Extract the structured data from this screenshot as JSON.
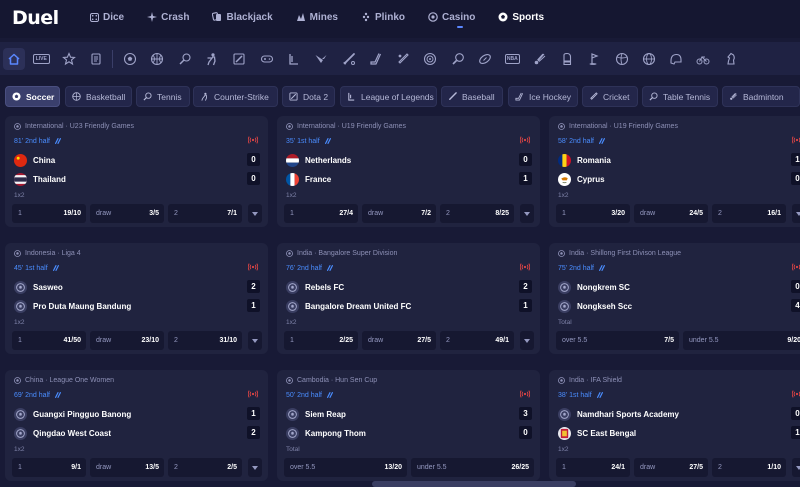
{
  "brand": {
    "logo": "Duel"
  },
  "topnav": [
    {
      "label": "Dice",
      "icon": "dice-icon"
    },
    {
      "label": "Crash",
      "icon": "crash-icon"
    },
    {
      "label": "Blackjack",
      "icon": "cards-icon"
    },
    {
      "label": "Mines",
      "icon": "mines-icon"
    },
    {
      "label": "Plinko",
      "icon": "plinko-icon"
    },
    {
      "label": "Casino",
      "icon": "casino-chip-icon"
    },
    {
      "label": "Sports",
      "icon": "soccer-ball-icon",
      "active": true
    }
  ],
  "iconbar": {
    "live_label": "LIVE",
    "nba_label": "NBA"
  },
  "categories": [
    {
      "label": "Soccer",
      "active": true
    },
    {
      "label": "Basketball"
    },
    {
      "label": "Tennis"
    },
    {
      "label": "Counter-Strike"
    },
    {
      "label": "Dota 2"
    },
    {
      "label": "League of Legends"
    },
    {
      "label": "Baseball"
    },
    {
      "label": "Ice Hockey"
    },
    {
      "label": "Cricket"
    },
    {
      "label": "Table Tennis"
    },
    {
      "label": "Badminton"
    }
  ],
  "matches": [
    {
      "league": "International · U23 Friendly Games",
      "time": "81' 2nd half",
      "teams": [
        {
          "name": "China",
          "score": "0",
          "flag": "china"
        },
        {
          "name": "Thailand",
          "score": "0",
          "flag": "thailand"
        }
      ],
      "market": "1x2",
      "odds": [
        {
          "label": "1",
          "value": "19/10"
        },
        {
          "label": "draw",
          "value": "3/5"
        },
        {
          "label": "2",
          "value": "7/1"
        }
      ]
    },
    {
      "league": "International · U19 Friendly Games",
      "time": "35' 1st half",
      "teams": [
        {
          "name": "Netherlands",
          "score": "0",
          "flag": "netherlands"
        },
        {
          "name": "France",
          "score": "1",
          "flag": "france"
        }
      ],
      "market": "1x2",
      "odds": [
        {
          "label": "1",
          "value": "27/4"
        },
        {
          "label": "draw",
          "value": "7/2"
        },
        {
          "label": "2",
          "value": "8/25"
        }
      ]
    },
    {
      "league": "International · U19 Friendly Games",
      "time": "58' 2nd half",
      "teams": [
        {
          "name": "Romania",
          "score": "1",
          "flag": "romania"
        },
        {
          "name": "Cyprus",
          "score": "0",
          "flag": "cyprus"
        }
      ],
      "market": "1x2",
      "odds": [
        {
          "label": "1",
          "value": "3/20"
        },
        {
          "label": "draw",
          "value": "24/5"
        },
        {
          "label": "2",
          "value": "16/1"
        }
      ]
    },
    {
      "league": "Indonesia · Liga 4",
      "time": "45' 1st half",
      "teams": [
        {
          "name": "Sasweo",
          "score": "2",
          "flag": "generic"
        },
        {
          "name": "Pro Duta Maung Bandung",
          "score": "1",
          "flag": "generic"
        }
      ],
      "market": "1x2",
      "odds": [
        {
          "label": "1",
          "value": "41/50"
        },
        {
          "label": "draw",
          "value": "23/10"
        },
        {
          "label": "2",
          "value": "31/10"
        }
      ]
    },
    {
      "league": "India · Bangalore Super Division",
      "time": "76' 2nd half",
      "teams": [
        {
          "name": "Rebels FC",
          "score": "2",
          "flag": "generic"
        },
        {
          "name": "Bangalore Dream United FC",
          "score": "1",
          "flag": "generic"
        }
      ],
      "market": "1x2",
      "odds": [
        {
          "label": "1",
          "value": "2/25"
        },
        {
          "label": "draw",
          "value": "27/5"
        },
        {
          "label": "2",
          "value": "49/1"
        }
      ]
    },
    {
      "league": "India · Shillong First Divison League",
      "time": "75' 2nd half",
      "teams": [
        {
          "name": "Nongkrem SC",
          "score": "0",
          "flag": "generic"
        },
        {
          "name": "Nongkseh Scc",
          "score": "4",
          "flag": "generic"
        }
      ],
      "market": "Total",
      "odds": [
        {
          "label": "over 5.5",
          "value": "7/5"
        },
        {
          "label": "under 5.5",
          "value": "9/20"
        }
      ]
    },
    {
      "league": "China · League One Women",
      "time": "69' 2nd half",
      "teams": [
        {
          "name": "Guangxi Pingguo Banong",
          "score": "1",
          "flag": "generic"
        },
        {
          "name": "Qingdao West Coast",
          "score": "2",
          "flag": "generic"
        }
      ],
      "market": "1x2",
      "odds": [
        {
          "label": "1",
          "value": "9/1"
        },
        {
          "label": "draw",
          "value": "13/5"
        },
        {
          "label": "2",
          "value": "2/5"
        }
      ]
    },
    {
      "league": "Cambodia · Hun Sen Cup",
      "time": "50' 2nd half",
      "teams": [
        {
          "name": "Siem Reap",
          "score": "3",
          "flag": "generic"
        },
        {
          "name": "Kampong Thom",
          "score": "0",
          "flag": "generic"
        }
      ],
      "market": "Total",
      "odds": [
        {
          "label": "over 5.5",
          "value": "13/20"
        },
        {
          "label": "under 5.5",
          "value": "26/25"
        }
      ]
    },
    {
      "league": "India · IFA Shield",
      "time": "38' 1st half",
      "teams": [
        {
          "name": "Namdhari Sports Academy",
          "score": "0",
          "flag": "generic"
        },
        {
          "name": "SC East Bengal",
          "score": "1",
          "flag": "eastbengal"
        }
      ],
      "market": "1x2",
      "odds": [
        {
          "label": "1",
          "value": "24/1"
        },
        {
          "label": "draw",
          "value": "27/5"
        },
        {
          "label": "2",
          "value": "1/10"
        }
      ]
    }
  ],
  "colors": {
    "accent": "#4a8dff",
    "live": "#e04545",
    "background": "#181a36",
    "card": "#20233f"
  }
}
